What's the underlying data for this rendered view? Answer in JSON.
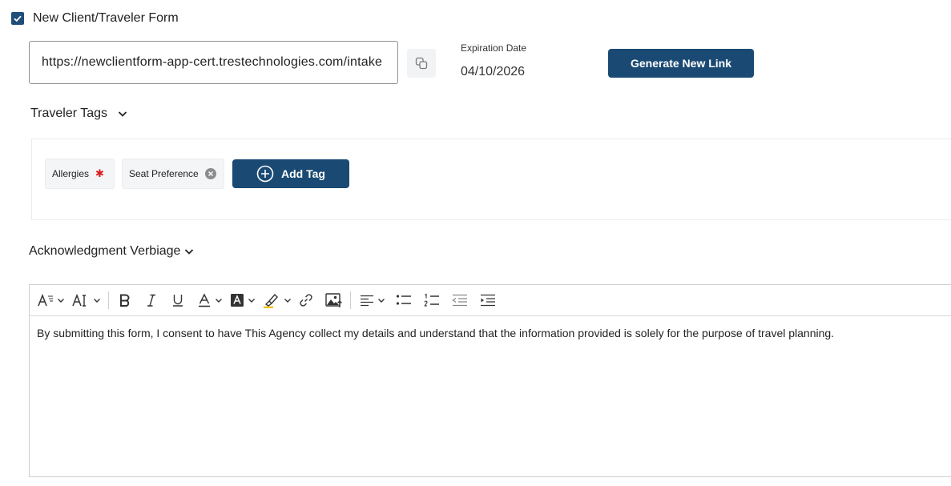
{
  "header": {
    "title": "New Client/Traveler Form",
    "checked": true
  },
  "link": {
    "url": "https://newclientform-app-cert.trestechnologies.com/intake"
  },
  "expiration": {
    "label": "Expiration Date",
    "value": "04/10/2026"
  },
  "buttons": {
    "generate_label": "Generate New Link",
    "add_tag_label": "Add Tag"
  },
  "tags": {
    "title": "Traveler Tags",
    "items": [
      {
        "label": "Allergies",
        "required": true
      },
      {
        "label": "Seat Preference",
        "removable": true
      }
    ]
  },
  "acknowledgment": {
    "title": "Acknowledgment Verbiage",
    "text": "By submitting this form, I consent to have This Agency collect my details and understand that the information provided is solely for the purpose of travel planning."
  },
  "colors": {
    "primary": "#1a4a73",
    "required": "#d61f1f",
    "border": "#8f8f8f"
  },
  "toolbar_icons": [
    "paragraph-format-icon",
    "font-size-icon",
    "bold-icon",
    "italic-icon",
    "underline-icon",
    "text-color-icon",
    "background-color-icon",
    "highlight-icon",
    "link-icon",
    "insert-image-icon",
    "align-icon",
    "bullet-list-icon",
    "numbered-list-icon",
    "outdent-icon",
    "indent-icon"
  ]
}
